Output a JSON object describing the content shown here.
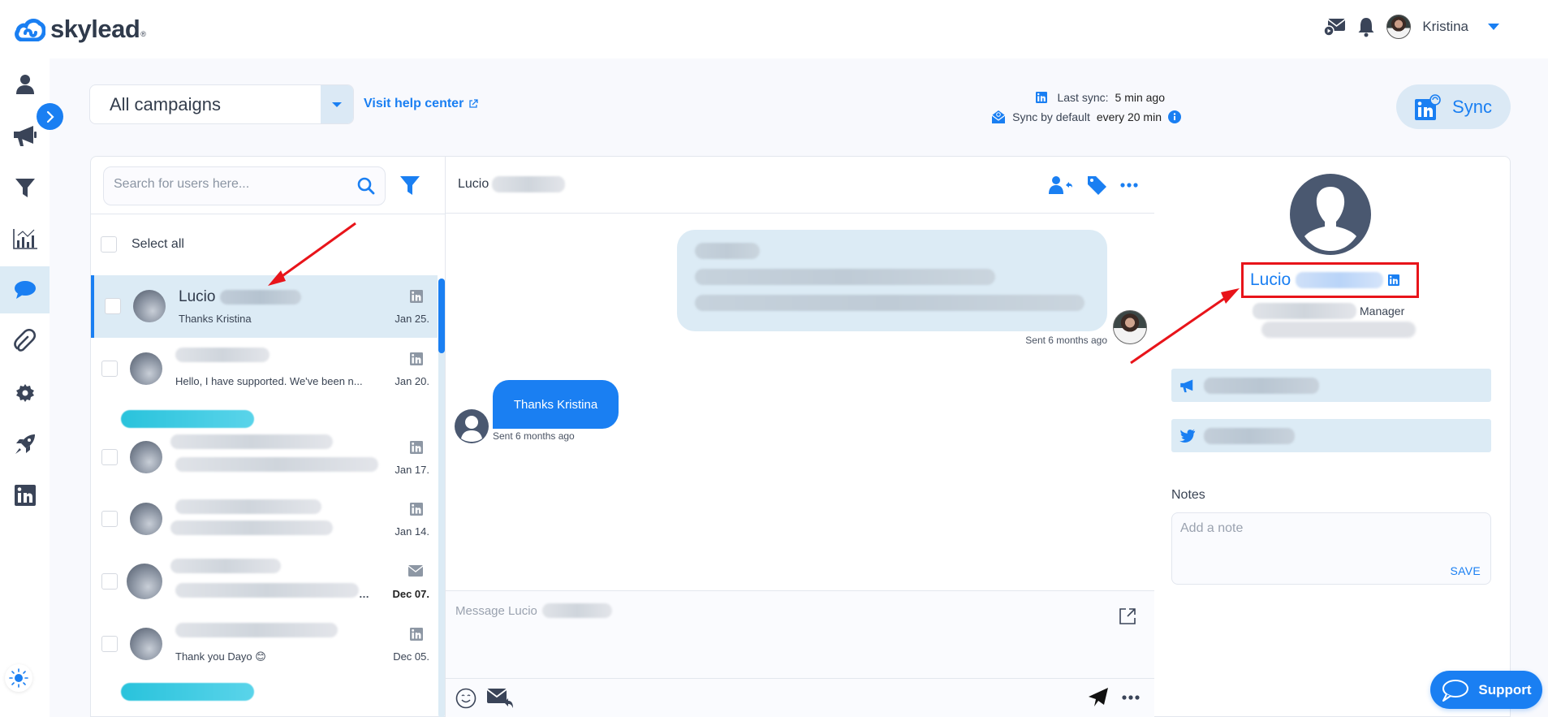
{
  "app": {
    "logo_text": "skylead",
    "logo_mark": "®"
  },
  "topbar": {
    "user_name": "Kristina",
    "icons": [
      "video-mail-icon",
      "bell-icon"
    ]
  },
  "sidebar": {
    "items": [
      {
        "name": "leads",
        "icon": "user-icon",
        "active": false
      },
      {
        "name": "campaigns",
        "icon": "megaphone-icon",
        "active": false
      },
      {
        "name": "blacklist",
        "icon": "filter-icon",
        "active": false
      },
      {
        "name": "statistics",
        "icon": "chart-icon",
        "active": false
      },
      {
        "name": "inbox",
        "icon": "chat-bubble-icon",
        "active": true
      },
      {
        "name": "integrations",
        "icon": "paperclip-icon",
        "active": false
      },
      {
        "name": "settings",
        "icon": "gear-icon",
        "active": false
      },
      {
        "name": "onboarding",
        "icon": "rocket-icon",
        "active": false
      },
      {
        "name": "linkedin-accounts",
        "icon": "linkedin-icon",
        "active": false
      }
    ]
  },
  "toolbar": {
    "campaign_select": "All campaigns",
    "help_link": "Visit help center",
    "last_sync_label": "Last sync:",
    "last_sync_value": "5 min ago",
    "sync_default_label": "Sync by default",
    "sync_default_value": "every 20 min",
    "sync_button": "Sync"
  },
  "inbox": {
    "search_placeholder": "Search for users here...",
    "select_all": "Select all",
    "conversations": [
      {
        "name": "Lucio",
        "snippet": "Thanks Kristina",
        "date": "Jan 25.",
        "channel": "linkedin",
        "selected": true,
        "bold": false
      },
      {
        "name": "",
        "snippet": "Hello, I have supported. We've been n...",
        "date": "Jan 20.",
        "channel": "linkedin",
        "selected": false,
        "bold": false
      },
      {
        "name": "",
        "snippet": "",
        "date": "Jan 17.",
        "channel": "linkedin",
        "selected": false,
        "bold": false
      },
      {
        "name": "",
        "snippet": "",
        "date": "Jan 14.",
        "channel": "linkedin",
        "selected": false,
        "bold": false
      },
      {
        "name": "",
        "snippet": "",
        "date": "Dec 07.",
        "channel": "email",
        "selected": false,
        "bold": true
      },
      {
        "name": "",
        "snippet": "Thank you Dayo 😊",
        "date": "Dec 05.",
        "channel": "linkedin",
        "selected": false,
        "bold": false
      }
    ]
  },
  "chat": {
    "header_name": "Lucio",
    "messages": [
      {
        "direction": "outgoing",
        "text": "",
        "meta": "Sent 6 months ago"
      },
      {
        "direction": "incoming",
        "text": "Thanks Kristina",
        "meta": "Sent 6 months ago"
      }
    ],
    "composer_placeholder": "Message Lucio"
  },
  "profile": {
    "first_name": "Lucio",
    "title_suffix": "Manager",
    "notes_label": "Notes",
    "notes_placeholder": "Add a note",
    "notes_save": "SAVE"
  },
  "support": {
    "label": "Support"
  },
  "colors": {
    "accent": "#1a7ff2",
    "selected_bg": "#dcebf5",
    "annotation": "#e8141a",
    "tag": "#29c3dc"
  }
}
